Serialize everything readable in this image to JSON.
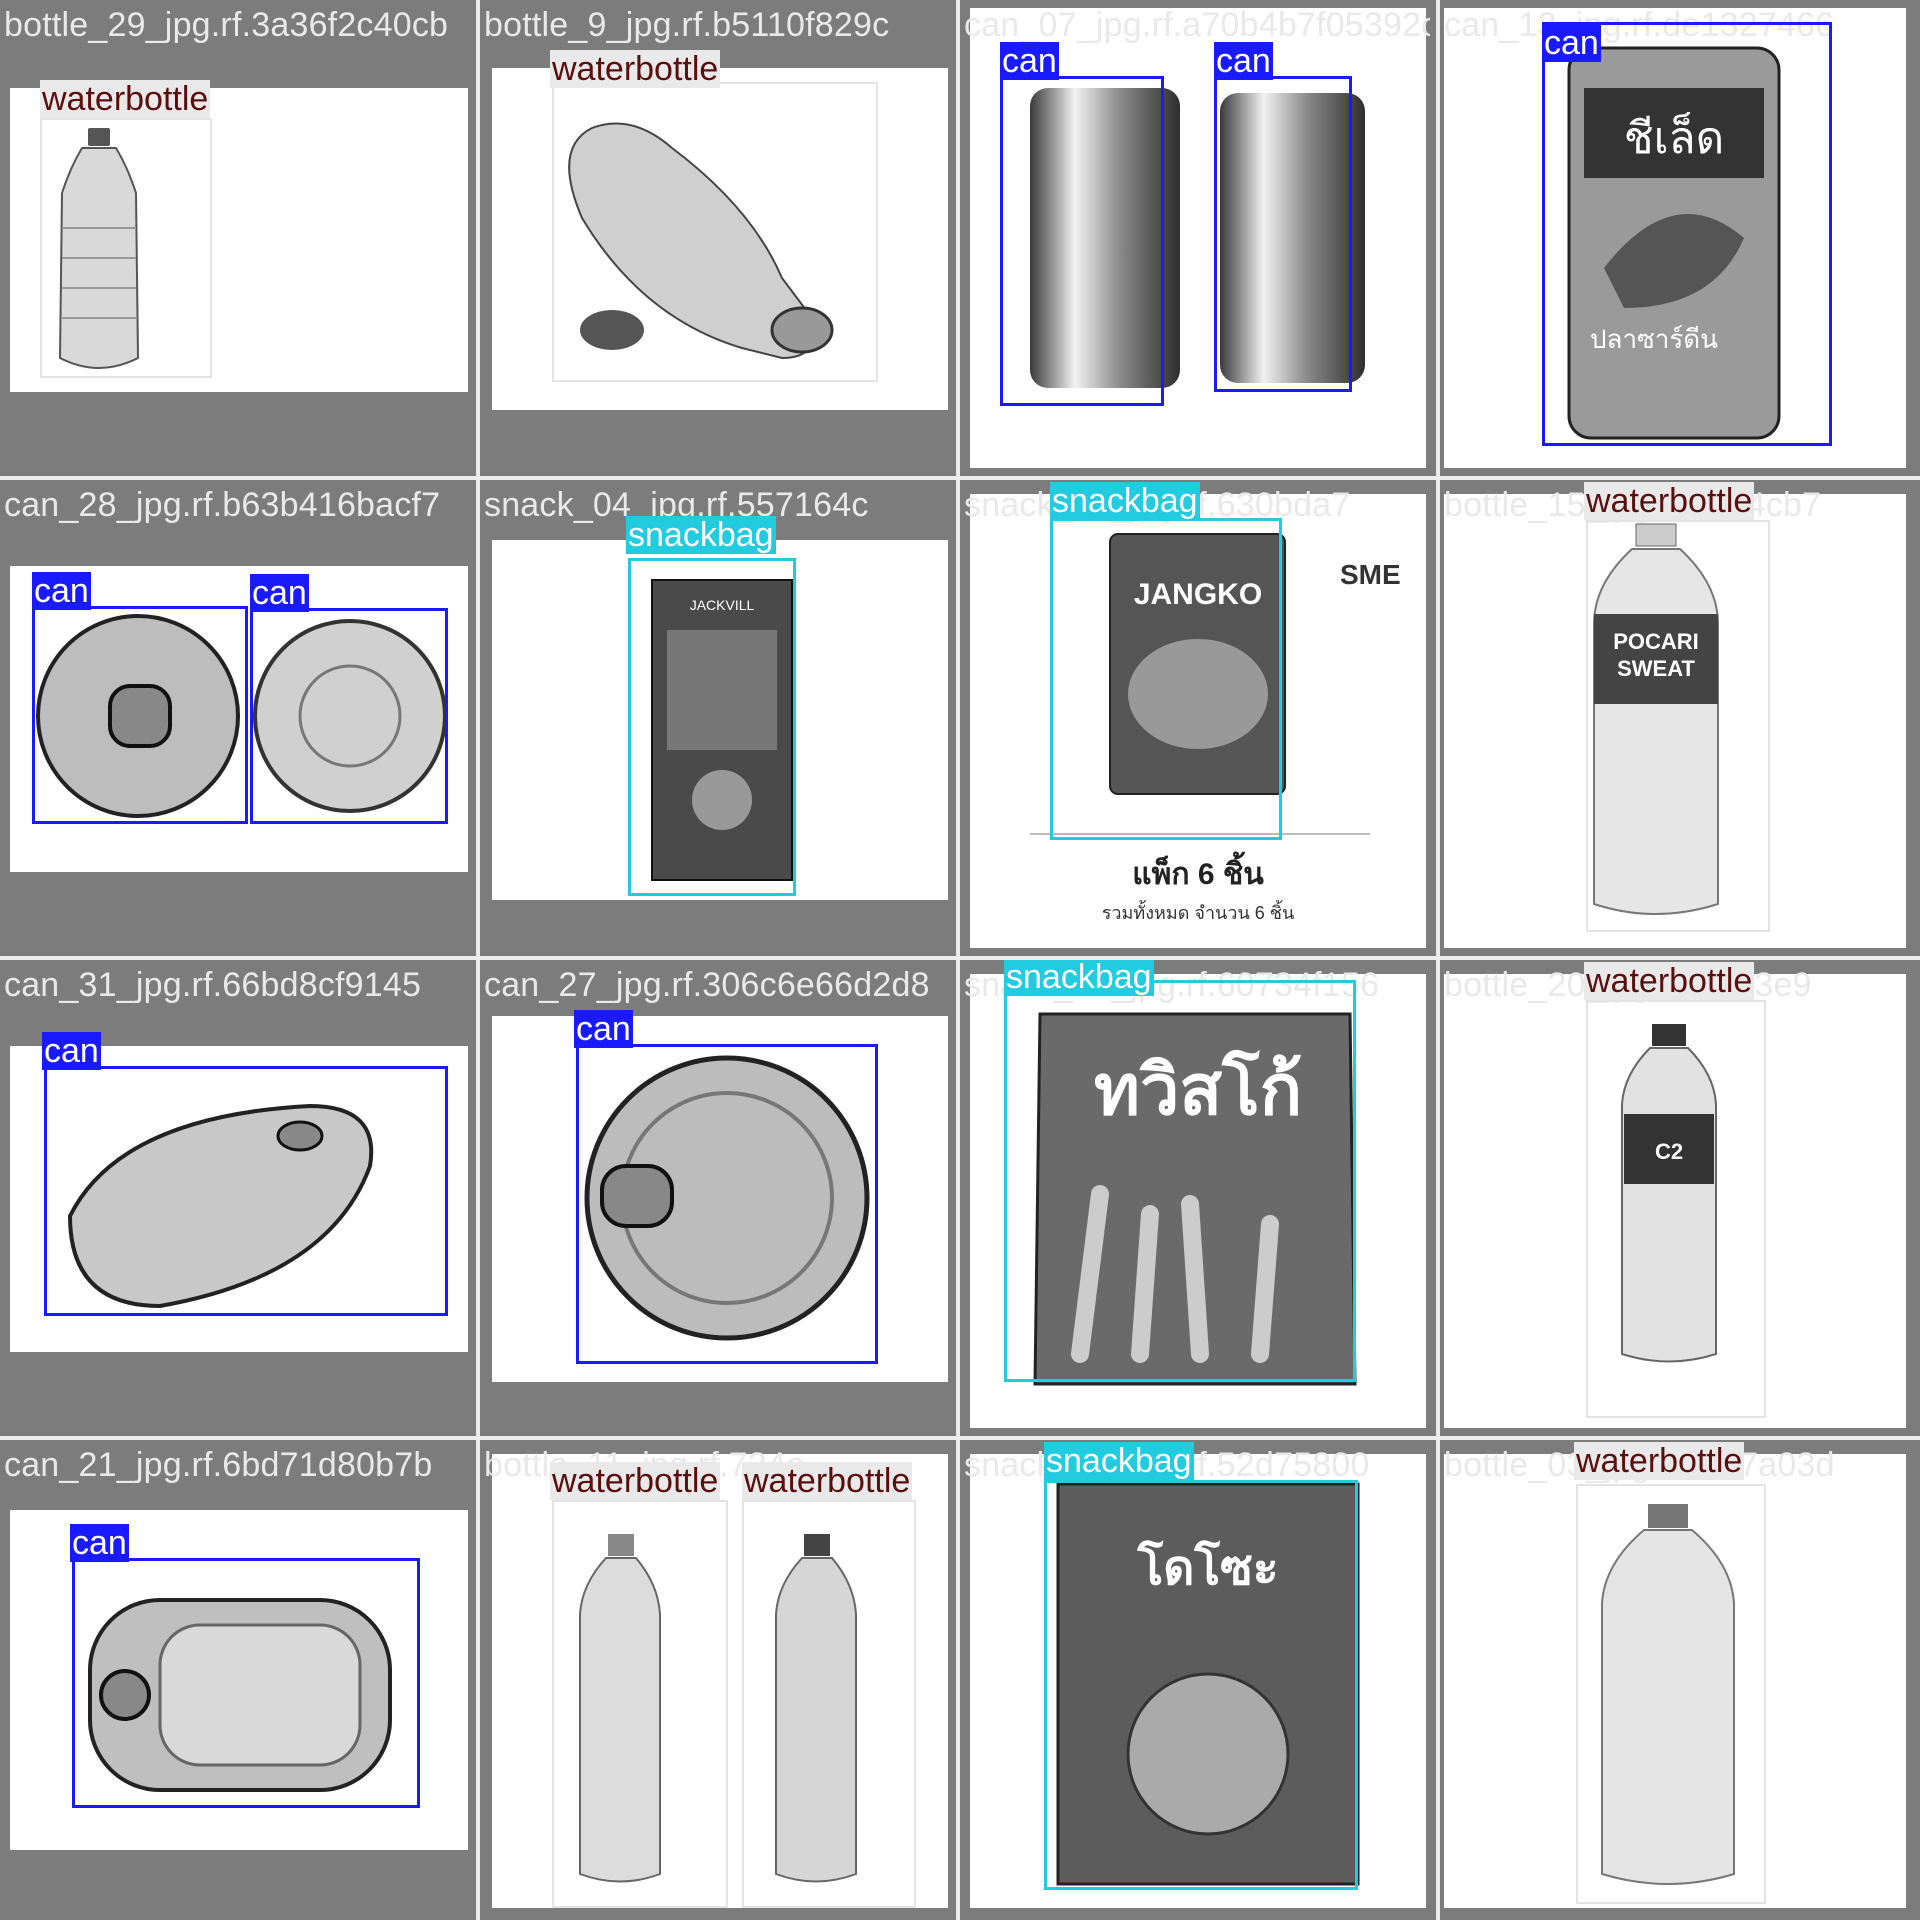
{
  "colors": {
    "can": "#1a1aff",
    "snackbag": "#22cbde",
    "waterbottle": "#5a0f0f",
    "tile_bg": "#7c7c7c"
  },
  "tiles": [
    {
      "filename": "bottle_29_jpg.rf.3a36f2c40cb",
      "labels": [
        "waterbottle"
      ]
    },
    {
      "filename": "bottle_9_jpg.rf.b5110f829c",
      "labels": [
        "waterbottle"
      ]
    },
    {
      "filename": "can_07_jpg.rf.a70b4b7f05392c",
      "labels": [
        "can",
        "can"
      ]
    },
    {
      "filename": "can_13_jpg.rf.de1327466",
      "labels": [
        "can"
      ]
    },
    {
      "filename": "can_28_jpg.rf.b63b416bacf7",
      "labels": [
        "can",
        "can"
      ]
    },
    {
      "filename": "snack_04_jpg.rf.557164c",
      "labels": [
        "snackbag"
      ]
    },
    {
      "filename": "snack_16_jpg.rf.630bda7",
      "labels": [
        "snackbag"
      ]
    },
    {
      "filename": "bottle_15_jpg.rf.c074cb7",
      "labels": [
        "waterbottle"
      ]
    },
    {
      "filename": "can_31_jpg.rf.66bd8cf9145",
      "labels": [
        "can"
      ]
    },
    {
      "filename": "can_27_jpg.rf.306c6e66d2d8",
      "labels": [
        "can"
      ]
    },
    {
      "filename": "snack_09_jpg.rf.60734f156",
      "labels": [
        "snackbag"
      ]
    },
    {
      "filename": "bottle_20_jpg.rf.1cfc3e9",
      "labels": [
        "waterbottle"
      ]
    },
    {
      "filename": "can_21_jpg.rf.6bd71d80b7b",
      "labels": [
        "can"
      ]
    },
    {
      "filename": "bottle_11_jpg.rf.734e",
      "labels": [
        "waterbottle",
        "waterbottle"
      ]
    },
    {
      "filename": "snack_22_jpg.rf.52d75800",
      "labels": [
        "snackbag"
      ]
    },
    {
      "filename": "bottle_03_jpg.rf.fd47a03d",
      "labels": [
        "waterbottle"
      ]
    }
  ],
  "product_text": {
    "sme": "SME",
    "pack_line1": "แพ็ก 6 ชิ้น",
    "pack_line2": "รวมทั้งหมด จำนวน 6 ชิ้น",
    "pocari_line1": "POCARI",
    "pocari_line2": "SWEAT",
    "jangko": "JANGKO",
    "jackvill": "JACKVILL",
    "thai_can_brand": "ชีเล็ด",
    "thai_can_sub": "ปลาซาร์ดีน",
    "twisko": "ทวิสโก้",
    "dozo": "โดโซะ",
    "c2": "C2"
  }
}
